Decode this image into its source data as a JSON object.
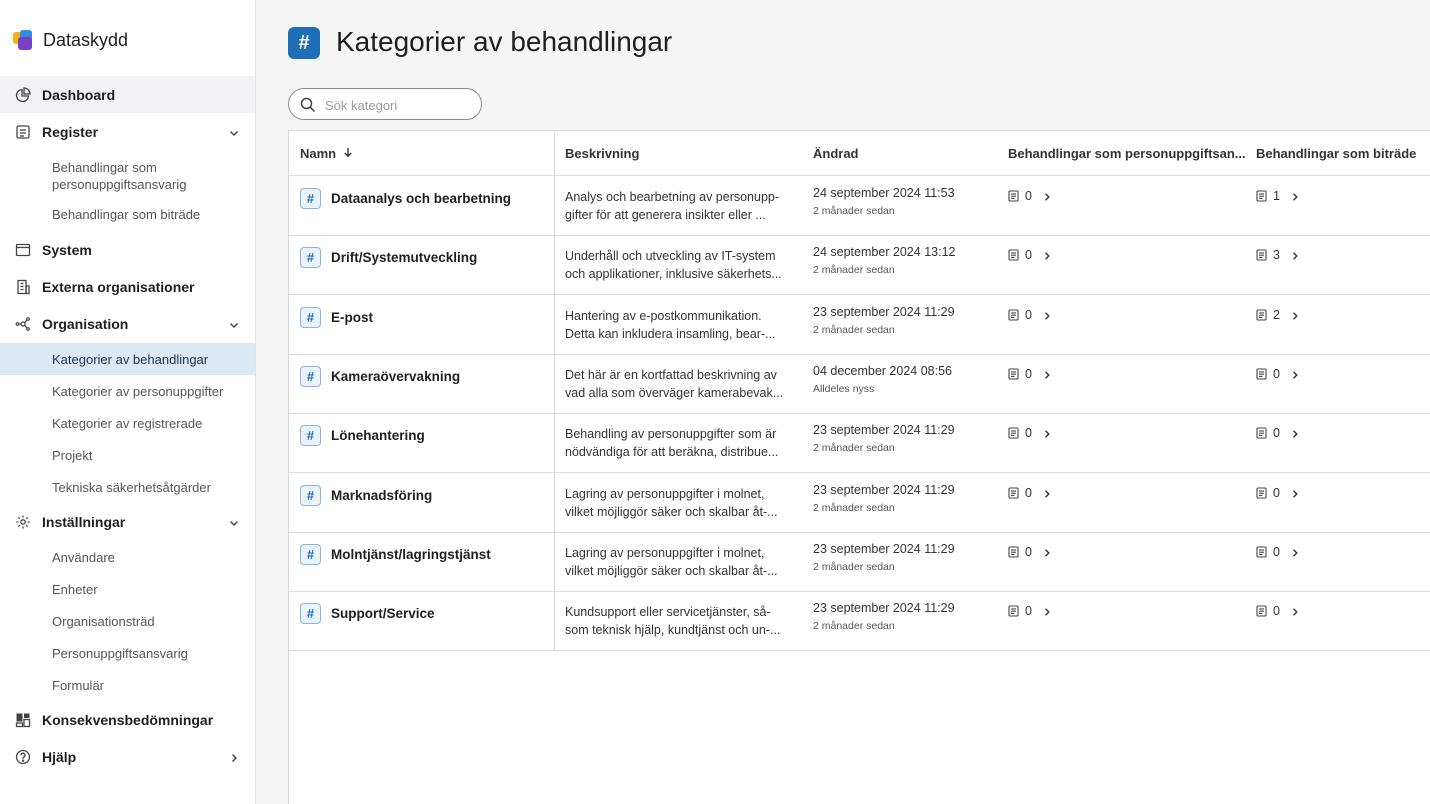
{
  "app": {
    "name": "Dataskydd"
  },
  "sidebar": {
    "dashboard": "Dashboard",
    "register": "Register",
    "register_sub": [
      "Behandlingar som personuppgiftsansvarig",
      "Behandlingar som biträde"
    ],
    "system": "System",
    "externa": "Externa organisationer",
    "organisation": "Organisation",
    "organisation_sub": [
      "Kategorier av behandlingar",
      "Kategorier av personuppgifter",
      "Kategorier av registrerade",
      "Projekt",
      "Tekniska säkerhetsåtgärder"
    ],
    "installningar": "Inställningar",
    "installningar_sub": [
      "Användare",
      "Enheter",
      "Organisationsträd",
      "Personuppgiftsansvarig",
      "Formulär"
    ],
    "konsekvens": "Konsekvensbedömningar",
    "hjalp": "Hjälp"
  },
  "page": {
    "icon": "#",
    "title": "Kategorier av behandlingar"
  },
  "search": {
    "placeholder": "Sök kategori"
  },
  "table": {
    "headers": {
      "name": "Namn",
      "description": "Beskrivning",
      "changed": "Ändrad",
      "controller": "Behandlingar som personuppgiftsan...",
      "processor": "Behandlingar som biträde"
    },
    "rows": [
      {
        "name": "Dataanalys och bearbetning",
        "desc1": "Analys och bearbetning av personupp-",
        "desc2": "gifter för att generera insikter eller ...",
        "date": "24 september 2024 11:53",
        "relative": "2 månader sedan",
        "controller_count": "0",
        "processor_count": "1"
      },
      {
        "name": "Drift/Systemutveckling",
        "desc1": "Underhåll och utveckling av IT-system",
        "desc2": "och applikationer, inklusive säkerhets...",
        "date": "24 september 2024 13:12",
        "relative": "2 månader sedan",
        "controller_count": "0",
        "processor_count": "3"
      },
      {
        "name": "E-post",
        "desc1": "Hantering av e-postkommunikation.",
        "desc2": "Detta kan inkludera insamling, bear-...",
        "date": "23 september 2024 11:29",
        "relative": "2 månader sedan",
        "controller_count": "0",
        "processor_count": "2"
      },
      {
        "name": "Kameraövervakning",
        "desc1": "Det här är en kortfattad beskrivning av",
        "desc2": "vad alla som överväger kamerabevak...",
        "date": "04 december 2024 08:56",
        "relative": "Alldeles nyss",
        "controller_count": "0",
        "processor_count": "0"
      },
      {
        "name": "Lönehantering",
        "desc1": "Behandling av personuppgifter som är",
        "desc2": "nödvändiga för att beräkna, distribue...",
        "date": "23 september 2024 11:29",
        "relative": "2 månader sedan",
        "controller_count": "0",
        "processor_count": "0"
      },
      {
        "name": "Marknadsföring",
        "desc1": "Lagring av personuppgifter i molnet,",
        "desc2": "vilket möjliggör säker och skalbar åt-...",
        "date": "23 september 2024 11:29",
        "relative": "2 månader sedan",
        "controller_count": "0",
        "processor_count": "0"
      },
      {
        "name": "Molntjänst/lagringstjänst",
        "desc1": "Lagring av personuppgifter i molnet,",
        "desc2": "vilket möjliggör säker och skalbar åt-...",
        "date": "23 september 2024 11:29",
        "relative": "2 månader sedan",
        "controller_count": "0",
        "processor_count": "0"
      },
      {
        "name": "Support/Service",
        "desc1": "Kundsupport eller servicetjänster, så-",
        "desc2": "som teknisk hjälp, kundtjänst och un-...",
        "date": "23 september 2024 11:29",
        "relative": "2 månader sedan",
        "controller_count": "0",
        "processor_count": "0"
      }
    ]
  },
  "colors": {
    "accent": "#1e6fb8",
    "active_bg": "#dde8f5"
  }
}
